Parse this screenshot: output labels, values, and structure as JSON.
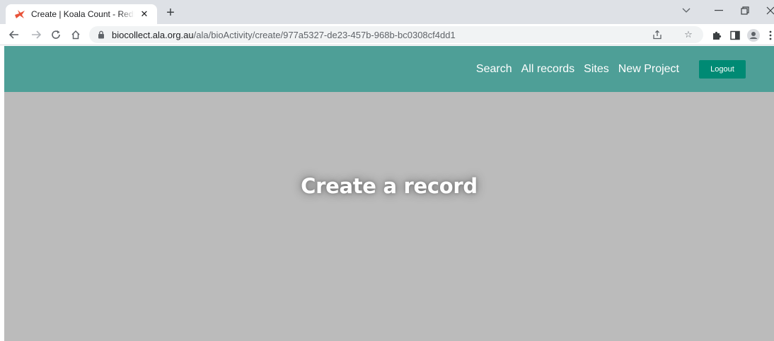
{
  "browser": {
    "tab": {
      "title": "Create | Koala Count - Redlands | Bi",
      "close_glyph": "✕",
      "favicon": "ala-bird-icon"
    },
    "new_tab_glyph": "+",
    "window_controls": {
      "tab_search": "⌵",
      "minimize": "—",
      "restore": "❐",
      "close": "✕"
    },
    "toolbar": {
      "back": "←",
      "forward": "→",
      "reload": "C",
      "home": "⌂",
      "url_host": "biocollect.ala.org.au",
      "url_path": "/ala/bioActivity/create/977a5327-de23-457b-968b-bc0308cf4dd1",
      "share_icon": "share-icon",
      "bookmark_glyph": "☆",
      "extensions_icon": "puzzle-icon",
      "sidepanel_icon": "side-panel-icon",
      "profile_icon": "profile-icon",
      "menu_glyph": "⋮"
    }
  },
  "site": {
    "header_color": "#4e9f97",
    "nav": {
      "search": "Search",
      "all_records": "All records",
      "sites": "Sites",
      "new_project": "New Project"
    },
    "logout_label": "Logout",
    "logout_color": "#008a74"
  },
  "hero": {
    "title": "Create a record",
    "background": "#bbbbbb"
  }
}
